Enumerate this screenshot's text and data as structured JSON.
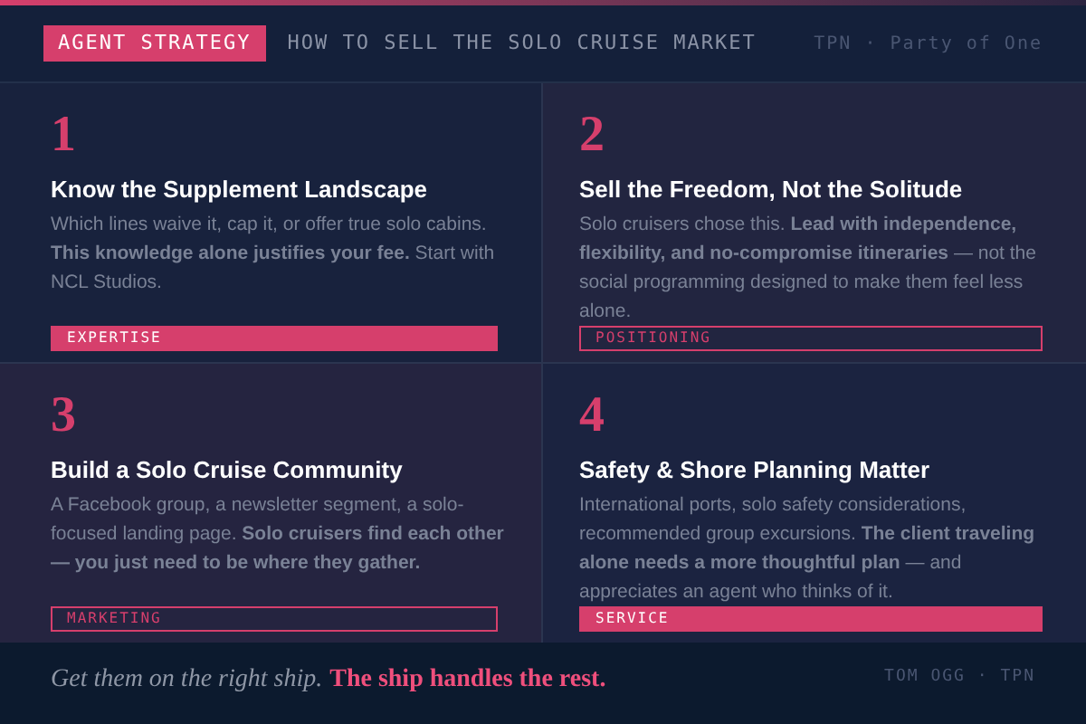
{
  "header": {
    "badge": "AGENT STRATEGY",
    "title": "HOW TO SELL THE SOLO CRUISE MARKET",
    "brand": "TPN · Party of One"
  },
  "cards": [
    {
      "number": "1",
      "title": "Know the Supplement Landscape",
      "body": "Which lines waive it, cap it, or offer true solo cabins. **This knowledge alone justifies your fee.** Start with NCL Studios.",
      "tag": "EXPERTISE",
      "kind": "filled"
    },
    {
      "number": "2",
      "title": "Sell the Freedom, Not the Solitude",
      "body": "Solo cruisers chose this. **Lead with independence, flexibility, and no-compromise itineraries** — not the social programming designed to make them feel less alone.",
      "tag": "POSITIONING",
      "kind": "outlined"
    },
    {
      "number": "3",
      "title": "Build a Solo Cruise Community",
      "body": "A Facebook group, a newsletter segment, a solo-focused landing page. **Solo cruisers find each other — you just need to be where they gather.**",
      "tag": "MARKETING",
      "kind": "outlined"
    },
    {
      "number": "4",
      "title": "Safety & Shore Planning Matter",
      "body": "International ports, solo safety considerations, recommended group excursions. **The client traveling alone needs a more thoughtful plan** — and appreciates an agent who thinks of it.",
      "tag": "SERVICE",
      "kind": "filled"
    }
  ],
  "footer": {
    "lead": "Get them on the right ship.",
    "emphasis": "The ship handles the rest.",
    "credit": "TOM OGG · TPN"
  }
}
